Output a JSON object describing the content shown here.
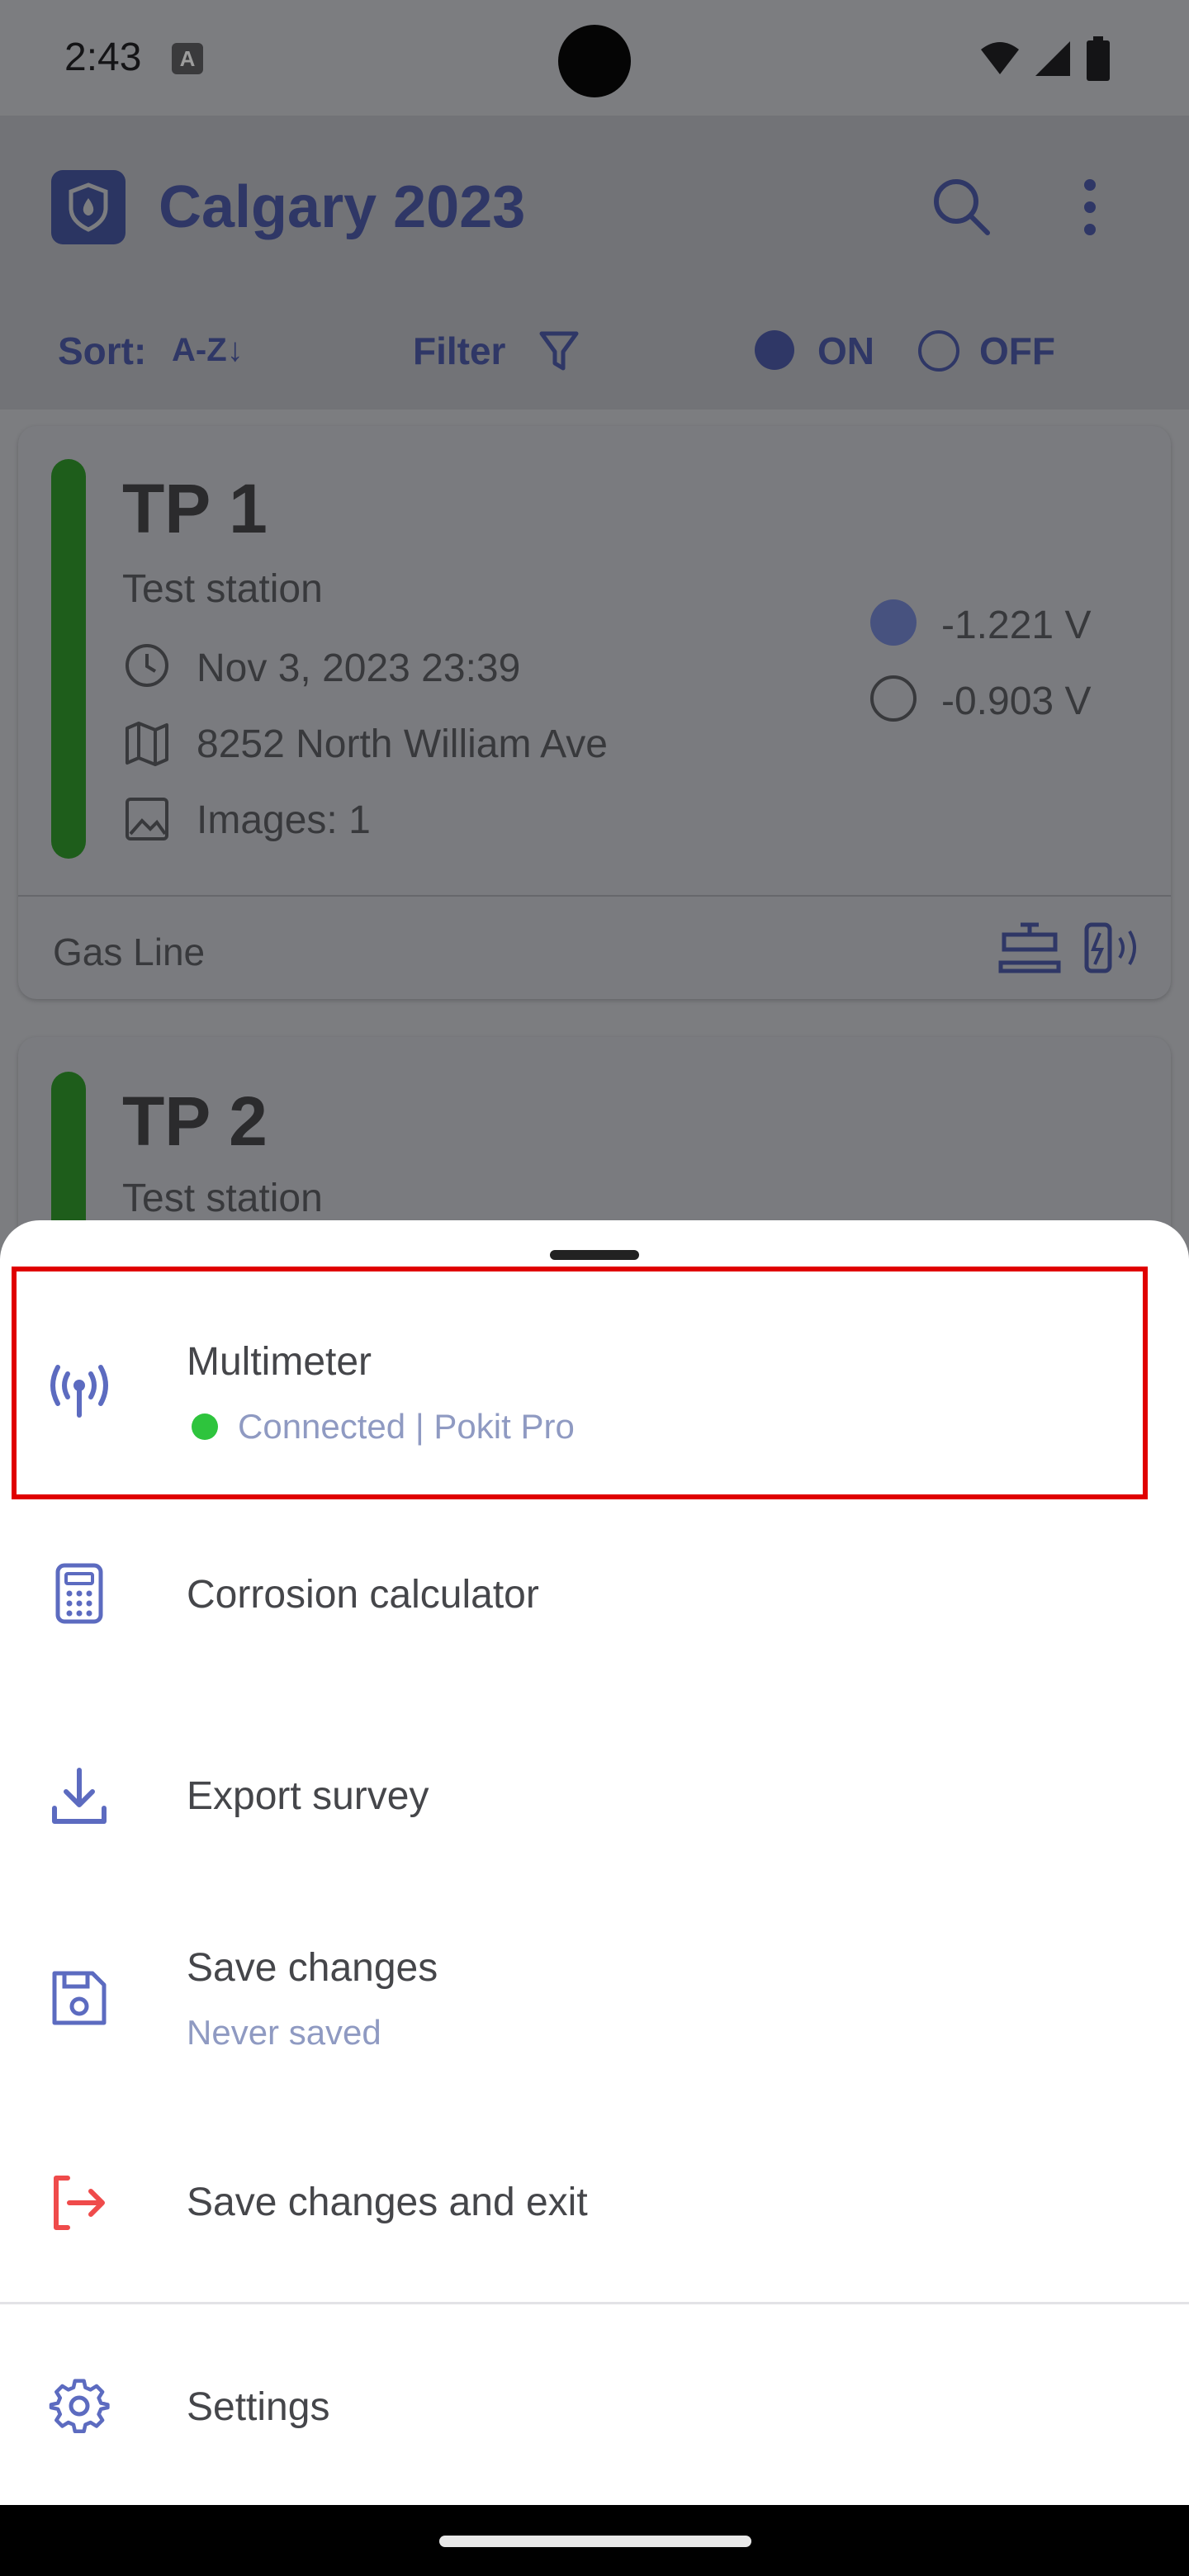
{
  "status_bar": {
    "time": "2:43",
    "notification_icon": "A"
  },
  "app_bar": {
    "title": "Calgary 2023",
    "sort_label": "Sort:",
    "sort_value": "A-Z↓",
    "filter_label": "Filter",
    "on_label": "ON",
    "off_label": "OFF"
  },
  "cards": [
    {
      "title": "TP 1",
      "subtitle": "Test station",
      "date": "Nov 3, 2023 23:39",
      "address": "8252 North William Ave",
      "images": "Images: 1",
      "on_voltage": "-1.221 V",
      "off_voltage": "-0.903 V",
      "footer": "Gas Line",
      "status_color": "#1e5d1b"
    },
    {
      "title": "TP 2",
      "subtitle": "Test station"
    }
  ],
  "sheet": {
    "items": [
      {
        "label": "Multimeter",
        "sub": "Connected | Pokit Pro",
        "icon": "antenna-icon",
        "status_color": "#2ec43d"
      },
      {
        "label": "Corrosion calculator",
        "icon": "calculator-icon"
      },
      {
        "label": "Export survey",
        "icon": "download-icon"
      },
      {
        "label": "Save changes",
        "sub": "Never saved",
        "icon": "save-icon"
      },
      {
        "label": "Save changes and exit",
        "icon": "exit-icon",
        "icon_color": "#ef4b4b"
      },
      {
        "label": "Settings",
        "icon": "gear-icon"
      }
    ]
  },
  "colors": {
    "accent": "#5c6bc0",
    "highlight": "#e00000"
  }
}
